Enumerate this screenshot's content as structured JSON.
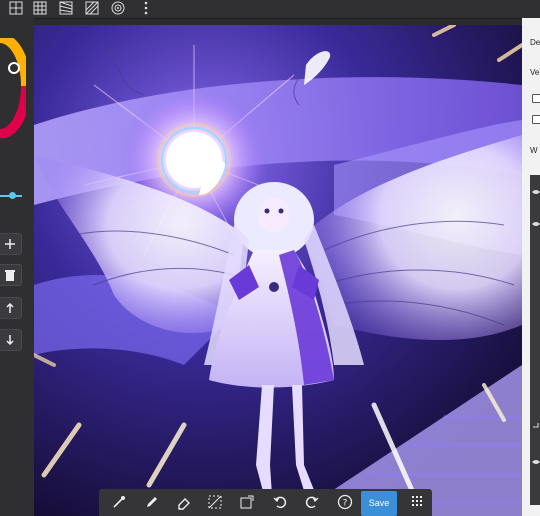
{
  "toolbar_top": {
    "icons": [
      "grid-square-icon",
      "grid-fine-icon",
      "perspective-left-icon",
      "perspective-right-icon",
      "radial-icon",
      "more-vert-icon"
    ]
  },
  "right_panel": {
    "label_top": "De",
    "label_second": "Ve",
    "label_third": "W"
  },
  "left_panel": {
    "buttons": [
      "add-layer-icon",
      "trash-icon",
      "arrow-up-icon",
      "arrow-down-icon"
    ]
  },
  "bottom_toolbar": {
    "icons": [
      "eyedropper-icon",
      "pen-icon",
      "eraser-icon",
      "selection-icon",
      "transform-icon",
      "undo-icon",
      "redo-icon",
      "help-icon"
    ],
    "save_label": "Save",
    "grid_icon": "keypad-icon"
  },
  "colors": {
    "accent": "#3a8fd8",
    "canvas_dark": "#1b1140",
    "glow": "#ffffff"
  }
}
